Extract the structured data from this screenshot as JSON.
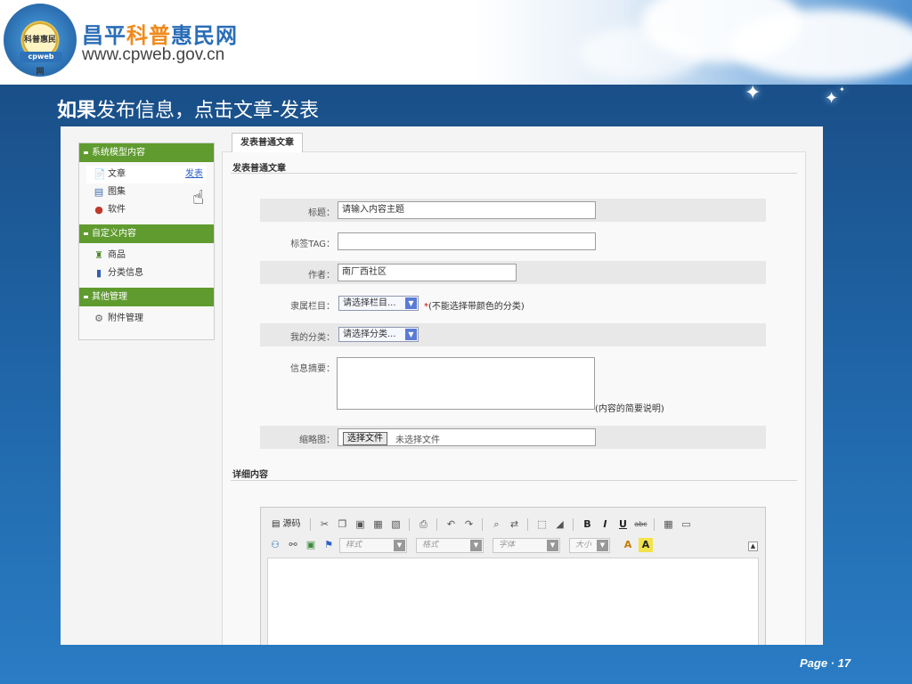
{
  "header": {
    "site_name_parts": [
      {
        "text": "昌平",
        "color": "#2a6db7"
      },
      {
        "text": "科普",
        "color": "#f08a1c"
      },
      {
        "text": "惠民网",
        "color": "#2a6db7"
      }
    ],
    "site_url": "www.cpweb.gov.cn",
    "logo_inner": "科普惠民网",
    "logo_band": "cpweb"
  },
  "slide": {
    "title_bold": "如果",
    "title_rest": "发布信息，点击文章-发表",
    "page_label": "Page · 17"
  },
  "sidebar": {
    "sections": [
      {
        "title": "系统模型内容",
        "items": [
          {
            "label": "文章",
            "icon": "📄",
            "link": "发表"
          },
          {
            "label": "图集",
            "icon": "▤"
          },
          {
            "label": "软件",
            "icon": "●"
          }
        ]
      },
      {
        "title": "自定义内容",
        "items": [
          {
            "label": "商品",
            "icon": "♜"
          },
          {
            "label": "分类信息",
            "icon": "▮"
          }
        ]
      },
      {
        "title": "其他管理",
        "items": [
          {
            "label": "附件管理",
            "icon": "⚙"
          }
        ]
      }
    ]
  },
  "form": {
    "tab": "发表普通文章",
    "heading": "发表普通文章",
    "title_label": "标题：",
    "title_value": "请输入内容主题",
    "tag_label": "标签TAG：",
    "tag_value": "",
    "author_label": "作者：",
    "author_value": "南厂西社区",
    "column_label": "隶属栏目：",
    "column_value": "请选择栏目...",
    "column_note_star": "*",
    "column_note": "(不能选择带颜色的分类)",
    "category_label": "我的分类：",
    "category_value": "请选择分类...",
    "summary_label": "信息摘要：",
    "summary_note": "(内容的简要说明)",
    "thumb_label": "缩略图：",
    "file_button": "选择文件",
    "file_status": "未选择文件",
    "detail_heading": "详细内容"
  },
  "editor": {
    "source_label": "源码",
    "style_combo": "样式",
    "format_combo": "格式",
    "font_combo": "字体",
    "size_combo": "大小",
    "bold": "B",
    "italic": "I",
    "underline": "U",
    "strike": "abc"
  }
}
